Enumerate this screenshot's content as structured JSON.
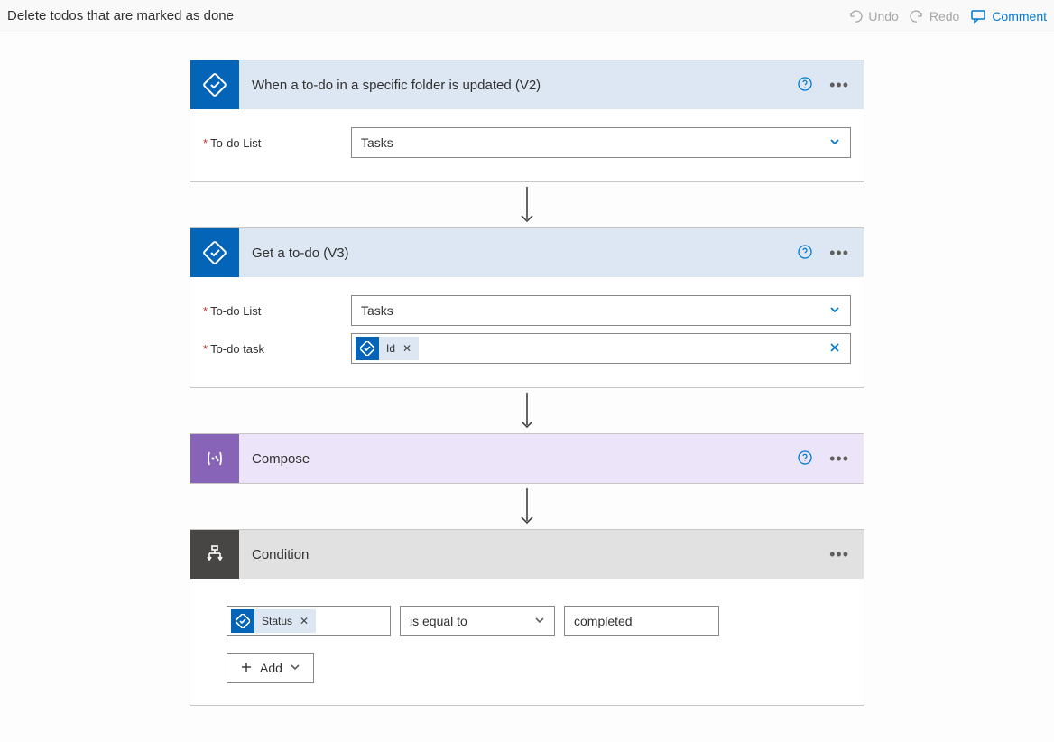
{
  "topbar": {
    "title": "Delete todos that are marked as done",
    "undo": "Undo",
    "redo": "Redo",
    "comment": "Comment"
  },
  "trigger": {
    "title": "When a to-do in a specific folder is updated (V2)",
    "param_list_label": "To-do List",
    "list_value": "Tasks"
  },
  "get_todo": {
    "title": "Get a to-do (V3)",
    "param_list_label": "To-do List",
    "list_value": "Tasks",
    "param_task_label": "To-do task",
    "token_label": "Id"
  },
  "compose": {
    "title": "Compose"
  },
  "condition": {
    "title": "Condition",
    "left_token": "Status",
    "operator": "is equal to",
    "right_value": "completed",
    "add_label": "Add"
  }
}
